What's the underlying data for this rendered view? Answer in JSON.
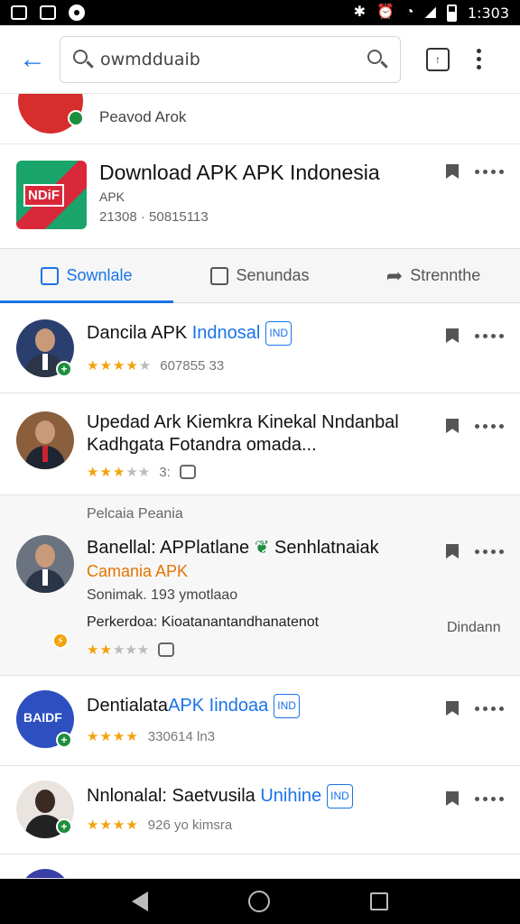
{
  "status_bar": {
    "time": "1:303"
  },
  "search": {
    "query": "owmdduaib"
  },
  "partial_item": {
    "text": "Peavod Arok"
  },
  "featured": {
    "icon_label": "NDiF",
    "title": "Download APK APK Indonesia",
    "subtitle": "APK",
    "meta": "21308 · 50815113"
  },
  "tabs": [
    {
      "label": "Sownlale",
      "icon": "download-icon"
    },
    {
      "label": "Senundas",
      "icon": "share-icon"
    },
    {
      "label": "Strennthe",
      "icon": "forward-arrow-icon"
    }
  ],
  "results": [
    {
      "title": "Dancila APK",
      "title_accent": "Indnosal",
      "tag": "IND",
      "rating": "4 stars",
      "meta": "607855 33"
    },
    {
      "title": "Upedad Ark Kiemkra Kinekal Nndanbal Kadhgata Fotandra omada...",
      "rating": "3 stars",
      "meta": "3:"
    },
    {
      "section": "Pelcaia Peania",
      "title": "Banellal: APPlatlane",
      "title_tail": "Senhlatnaiak",
      "title2": "Camania APK",
      "line1": "Sonimak. 193 ymotlaao",
      "line2": "Perkerdoa: Kioatanantandhanatenot",
      "side_text": "Dindann",
      "rating": "2 stars"
    },
    {
      "title": "Dentialata",
      "title_accent": "APK Iindoaa",
      "tag": "IND",
      "icon_label": "BAIDF",
      "rating": "4 stars",
      "meta": "330614 ln3"
    },
    {
      "title": "Nnlonalal: Saetvusila",
      "title_accent": "Unihine",
      "tag": "IND",
      "rating": "4 stars",
      "meta": "926 yo kimsra"
    }
  ],
  "colors": {
    "accent": "#1a73e8",
    "star": "#f2a20c",
    "badge": "#1e8e3e",
    "brand_red": "#d9283a"
  }
}
